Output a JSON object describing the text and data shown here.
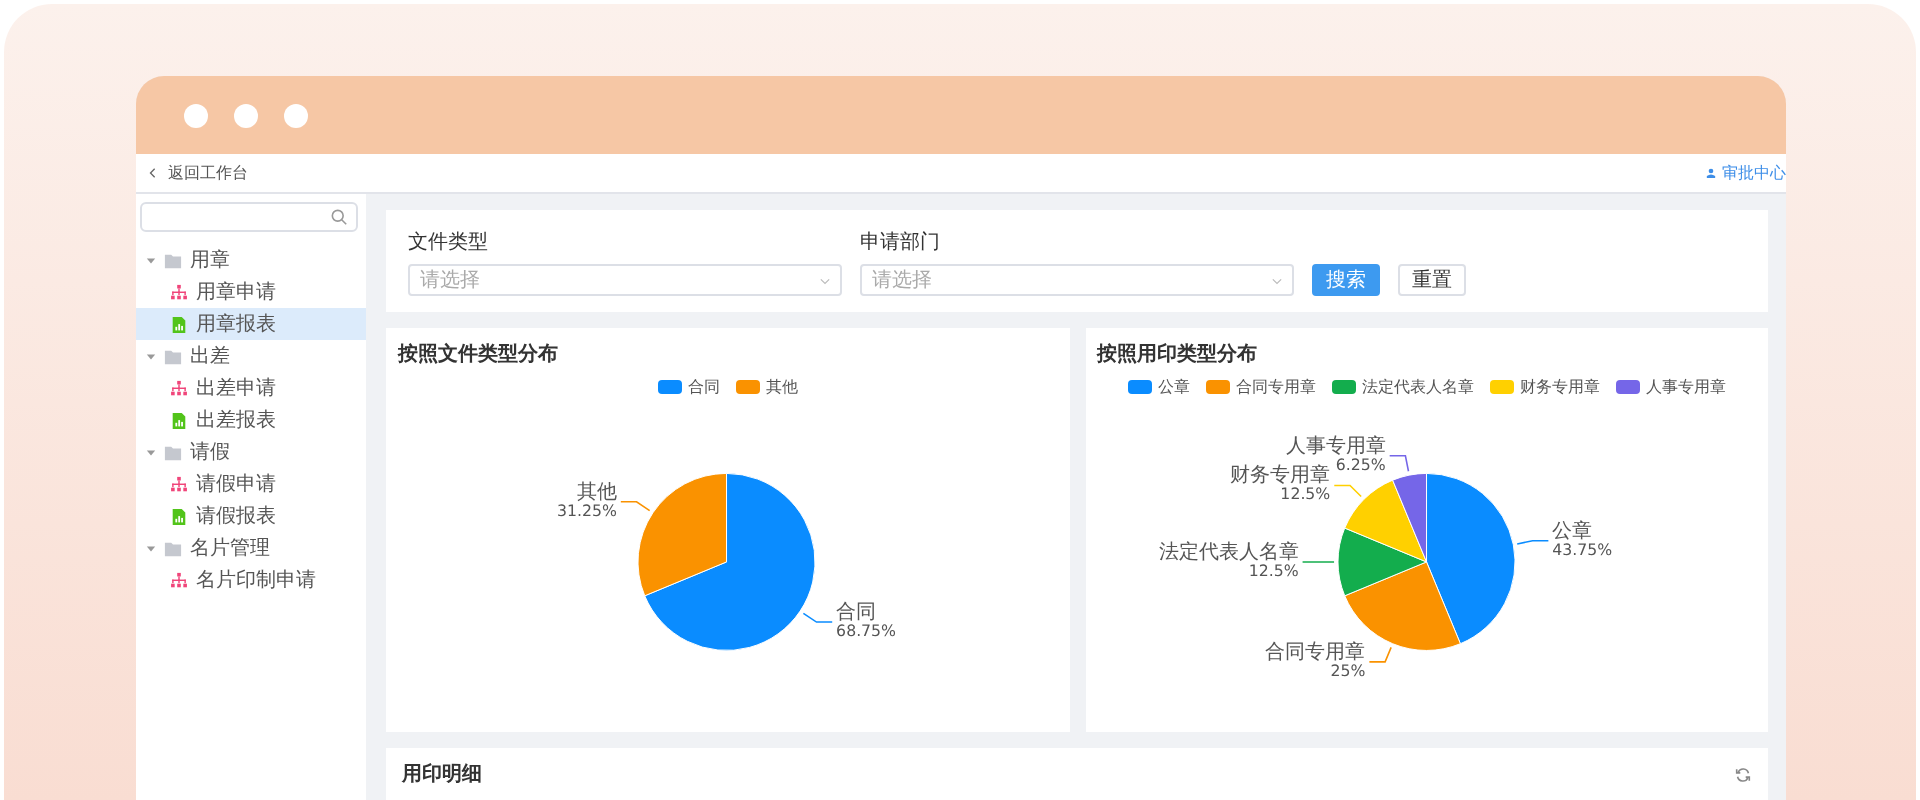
{
  "header": {
    "back_link": "返回工作台",
    "user_link": "审批中心"
  },
  "sidebar": {
    "items": [
      {
        "label": "用章",
        "kind": "folder",
        "expanded": true,
        "selected": false,
        "children": [
          {
            "label": "用章申请",
            "kind": "apply",
            "selected": false
          },
          {
            "label": "用章报表",
            "kind": "report",
            "selected": true
          }
        ]
      },
      {
        "label": "出差",
        "kind": "folder",
        "expanded": true,
        "selected": false,
        "children": [
          {
            "label": "出差申请",
            "kind": "apply",
            "selected": false
          },
          {
            "label": "出差报表",
            "kind": "report",
            "selected": false
          }
        ]
      },
      {
        "label": "请假",
        "kind": "folder",
        "expanded": true,
        "selected": false,
        "children": [
          {
            "label": "请假申请",
            "kind": "apply",
            "selected": false
          },
          {
            "label": "请假报表",
            "kind": "report",
            "selected": false
          }
        ]
      },
      {
        "label": "名片管理",
        "kind": "folder",
        "expanded": true,
        "selected": false,
        "children": [
          {
            "label": "名片印制申请",
            "kind": "apply",
            "selected": false
          }
        ]
      }
    ]
  },
  "filters": {
    "fields": [
      {
        "label": "文件类型",
        "placeholder": "请选择"
      },
      {
        "label": "申请部门",
        "placeholder": "请选择"
      }
    ],
    "buttons": [
      {
        "label": "搜索",
        "kind": "primary"
      },
      {
        "label": "重置",
        "kind": "default"
      }
    ]
  },
  "charts": [
    {
      "chart_data": {
        "type": "pie",
        "title": "按照文件类型分布",
        "categories": [
          "合同",
          "其他"
        ],
        "values": [
          68.75,
          31.25
        ],
        "colors": [
          "#0a8cff",
          "#fa9200"
        ],
        "value_labels": [
          "68.75%",
          "31.25%"
        ]
      }
    },
    {
      "chart_data": {
        "type": "pie",
        "title": "按照用印类型分布",
        "categories": [
          "公章",
          "合同专用章",
          "法定代表人名章",
          "财务专用章",
          "人事专用章"
        ],
        "values": [
          43.75,
          25,
          12.5,
          12.5,
          6.25
        ],
        "colors": [
          "#0a8cff",
          "#fa9200",
          "#13ad4d",
          "#ffd000",
          "#7566e8"
        ],
        "value_labels": [
          "43.75%",
          "25%",
          "12.5%",
          "12.5%",
          "6.25%"
        ]
      }
    }
  ],
  "detail": {
    "title": "用印明细"
  }
}
